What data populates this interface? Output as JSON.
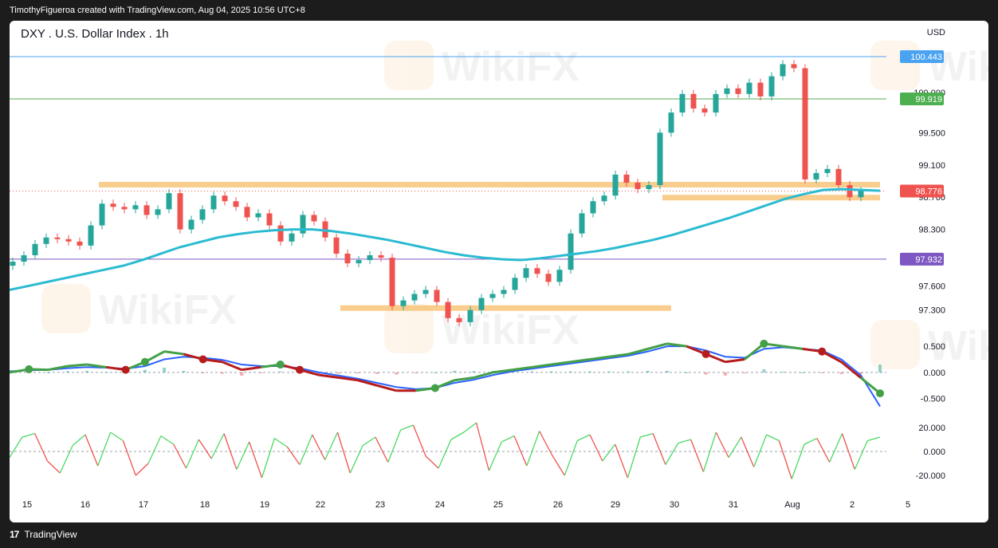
{
  "header": {
    "credit": "TimothyFigueroa created with TradingView.com, Aug 04, 2025 10:56 UTC+8"
  },
  "footer": {
    "brand": "TradingView"
  },
  "watermark": "WikiFX",
  "colors": {
    "up": "#26a69a",
    "down": "#ef5350",
    "ma": "#2bbbd1",
    "support_zone": "#f7c071",
    "blue_line": "#4aa3f0",
    "green_line": "#4caf50",
    "purple_line": "#7e57c2",
    "macd_line": "#2962ff",
    "rsi_up": "#4cd964",
    "rsi_down": "#ef5350"
  },
  "chart_data": [
    {
      "type": "candlestick",
      "title": "DXY . U.S. Dollar Index . 1h",
      "currency": "USD",
      "ylim": [
        97.05,
        100.75
      ],
      "x_ticks": [
        "15",
        "16",
        "17",
        "18",
        "19",
        "22",
        "23",
        "24",
        "25",
        "26",
        "29",
        "30",
        "31",
        "Aug",
        "2",
        "5"
      ],
      "y_ticks": [
        {
          "value": 100.0,
          "label": "100.000"
        },
        {
          "value": 99.5,
          "label": "99.500"
        },
        {
          "value": 99.1,
          "label": "99.100"
        },
        {
          "value": 98.7,
          "label": "98.700"
        },
        {
          "value": 98.3,
          "label": "98.300"
        },
        {
          "value": 97.6,
          "label": "97.600"
        },
        {
          "value": 97.3,
          "label": "97.300"
        }
      ],
      "price_labels": [
        {
          "value": 100.443,
          "label": "100.443",
          "color": "#4aa3f0"
        },
        {
          "value": 99.919,
          "label": "99.919",
          "color": "#4caf50"
        },
        {
          "value": 98.776,
          "label": "98.776",
          "color": "#ef5350"
        },
        {
          "value": 97.932,
          "label": "97.932",
          "color": "#7e57c2"
        }
      ],
      "levels": [
        {
          "value": 100.443,
          "color": "#4aa3f0"
        },
        {
          "value": 99.919,
          "color": "#4caf50"
        },
        {
          "value": 97.932,
          "color": "#7e57c2"
        }
      ],
      "zones": [
        {
          "from": 0.0,
          "to": 1.0,
          "value": 98.86
        },
        {
          "from": 0.75,
          "to": 1.0,
          "value": 98.7
        },
        {
          "from": 0.38,
          "to": 0.76,
          "value": 97.33
        }
      ],
      "close": [
        97.9,
        97.98,
        98.12,
        98.2,
        98.18,
        98.15,
        98.1,
        98.35,
        98.62,
        98.58,
        98.55,
        98.6,
        98.48,
        98.55,
        98.75,
        98.3,
        98.42,
        98.55,
        98.72,
        98.65,
        98.58,
        98.45,
        98.5,
        98.35,
        98.15,
        98.25,
        98.48,
        98.4,
        98.2,
        98.0,
        97.88,
        97.92,
        97.98,
        97.95,
        97.35,
        97.42,
        97.5,
        97.55,
        97.4,
        97.2,
        97.15,
        97.3,
        97.45,
        97.5,
        97.55,
        97.7,
        97.82,
        97.75,
        97.65,
        97.8,
        98.25,
        98.5,
        98.65,
        98.72,
        98.98,
        98.88,
        98.8,
        98.85,
        99.5,
        99.75,
        99.98,
        99.8,
        99.75,
        99.98,
        100.05,
        99.98,
        100.12,
        99.95,
        100.2,
        100.35,
        100.3,
        98.92,
        99.0,
        99.05,
        98.85,
        98.7,
        98.776
      ],
      "ma200": [
        97.55,
        97.6,
        97.65,
        97.7,
        97.75,
        97.8,
        97.85,
        97.92,
        98.0,
        98.08,
        98.14,
        98.2,
        98.24,
        98.27,
        98.29,
        98.3,
        98.3,
        98.28,
        98.25,
        98.21,
        98.17,
        98.12,
        98.07,
        98.02,
        97.98,
        97.95,
        97.93,
        97.92,
        97.94,
        97.97,
        98.0,
        98.03,
        98.07,
        98.12,
        98.17,
        98.23,
        98.3,
        98.37,
        98.44,
        98.52,
        98.6,
        98.68,
        98.74,
        98.79,
        98.8,
        98.79,
        98.78
      ],
      "extra_ma200_start": 0.0
    },
    {
      "type": "macd",
      "y_ticks": [
        {
          "value": 0.5,
          "label": "0.500"
        },
        {
          "value": 0.0,
          "label": "0.000"
        },
        {
          "value": -0.5,
          "label": "-0.500"
        }
      ],
      "ylim": [
        -0.75,
        0.7
      ],
      "macd": [
        0.0,
        0.06,
        0.05,
        0.12,
        0.15,
        0.1,
        0.05,
        0.2,
        0.4,
        0.35,
        0.25,
        0.2,
        0.05,
        0.1,
        0.15,
        0.05,
        -0.05,
        -0.1,
        -0.15,
        -0.25,
        -0.35,
        -0.35,
        -0.3,
        -0.15,
        -0.1,
        0.0,
        0.05,
        0.1,
        0.15,
        0.2,
        0.25,
        0.3,
        0.35,
        0.45,
        0.55,
        0.5,
        0.35,
        0.2,
        0.25,
        0.55,
        0.5,
        0.45,
        0.4,
        0.2,
        -0.1,
        -0.4
      ],
      "signal": [
        0.02,
        0.04,
        0.05,
        0.08,
        0.1,
        0.09,
        0.07,
        0.12,
        0.25,
        0.3,
        0.28,
        0.24,
        0.15,
        0.12,
        0.12,
        0.08,
        0.0,
        -0.06,
        -0.12,
        -0.2,
        -0.28,
        -0.32,
        -0.3,
        -0.2,
        -0.14,
        -0.05,
        0.02,
        0.07,
        0.12,
        0.17,
        0.22,
        0.27,
        0.32,
        0.4,
        0.5,
        0.5,
        0.42,
        0.3,
        0.28,
        0.45,
        0.48,
        0.45,
        0.42,
        0.25,
        -0.05,
        -0.65
      ]
    },
    {
      "type": "oscillator",
      "y_ticks": [
        {
          "value": 20,
          "label": "20.000"
        },
        {
          "value": 0,
          "label": "0.000"
        },
        {
          "value": -20,
          "label": "-20.000"
        }
      ],
      "ylim": [
        -30,
        30
      ],
      "values": [
        -5,
        12,
        15,
        -8,
        -18,
        5,
        14,
        -12,
        16,
        9,
        -20,
        -10,
        13,
        6,
        -14,
        10,
        -6,
        15,
        -15,
        8,
        -22,
        11,
        4,
        -11,
        14,
        -7,
        16,
        -18,
        5,
        12,
        -9,
        18,
        22,
        -4,
        -14,
        10,
        16,
        24,
        -16,
        8,
        13,
        -12,
        17,
        -3,
        -20,
        9,
        14,
        -8,
        6,
        -22,
        12,
        15,
        -11,
        7,
        10,
        -17,
        16,
        -5,
        12,
        -13,
        14,
        9,
        -23,
        6,
        11,
        -9,
        15,
        -15,
        9,
        12
      ]
    }
  ]
}
